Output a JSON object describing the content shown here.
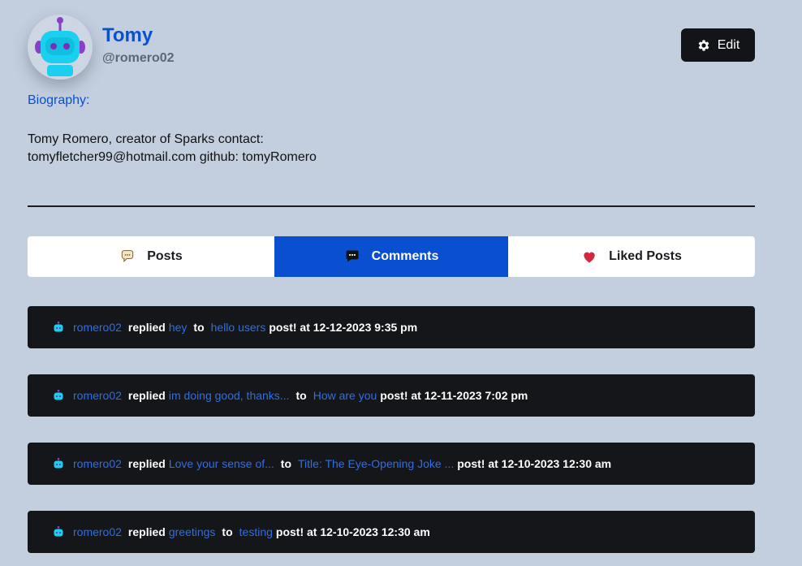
{
  "profile": {
    "name": "Tomy",
    "handle": "@romero02",
    "edit_label": "Edit",
    "bio_label": "Biography:",
    "bio_text": "Tomy Romero, creator of Sparks contact: tomyfletcher99@hotmail.com github: tomyRomero"
  },
  "tabs": [
    {
      "label": "Posts",
      "icon": "chat-bubble-icon",
      "active": false
    },
    {
      "label": "Comments",
      "icon": "comment-icon",
      "active": true
    },
    {
      "label": "Liked Posts",
      "icon": "heart-icon",
      "active": false
    }
  ],
  "comments": [
    {
      "user": "romero02",
      "replied": "replied",
      "reply": "hey",
      "to": "to",
      "post": "hello users",
      "suffix": "post! at 12-12-2023 9:35 pm"
    },
    {
      "user": "romero02",
      "replied": "replied",
      "reply": "im doing good, thanks...",
      "to": "to",
      "post": "How are you",
      "suffix": "post! at 12-11-2023 7:02 pm"
    },
    {
      "user": "romero02",
      "replied": "replied",
      "reply": "Love your sense of...",
      "to": "to",
      "post": "Title: The Eye-Opening Joke ...",
      "suffix": "post! at 12-10-2023 12:30 am"
    },
    {
      "user": "romero02",
      "replied": "replied",
      "reply": "greetings",
      "to": "to",
      "post": "testing",
      "suffix": "post! at 12-10-2023 12:30 am"
    }
  ],
  "colors": {
    "accent": "#0b4fd1",
    "background": "#c3cfde",
    "card": "#141619",
    "link": "#2f6ee6"
  }
}
